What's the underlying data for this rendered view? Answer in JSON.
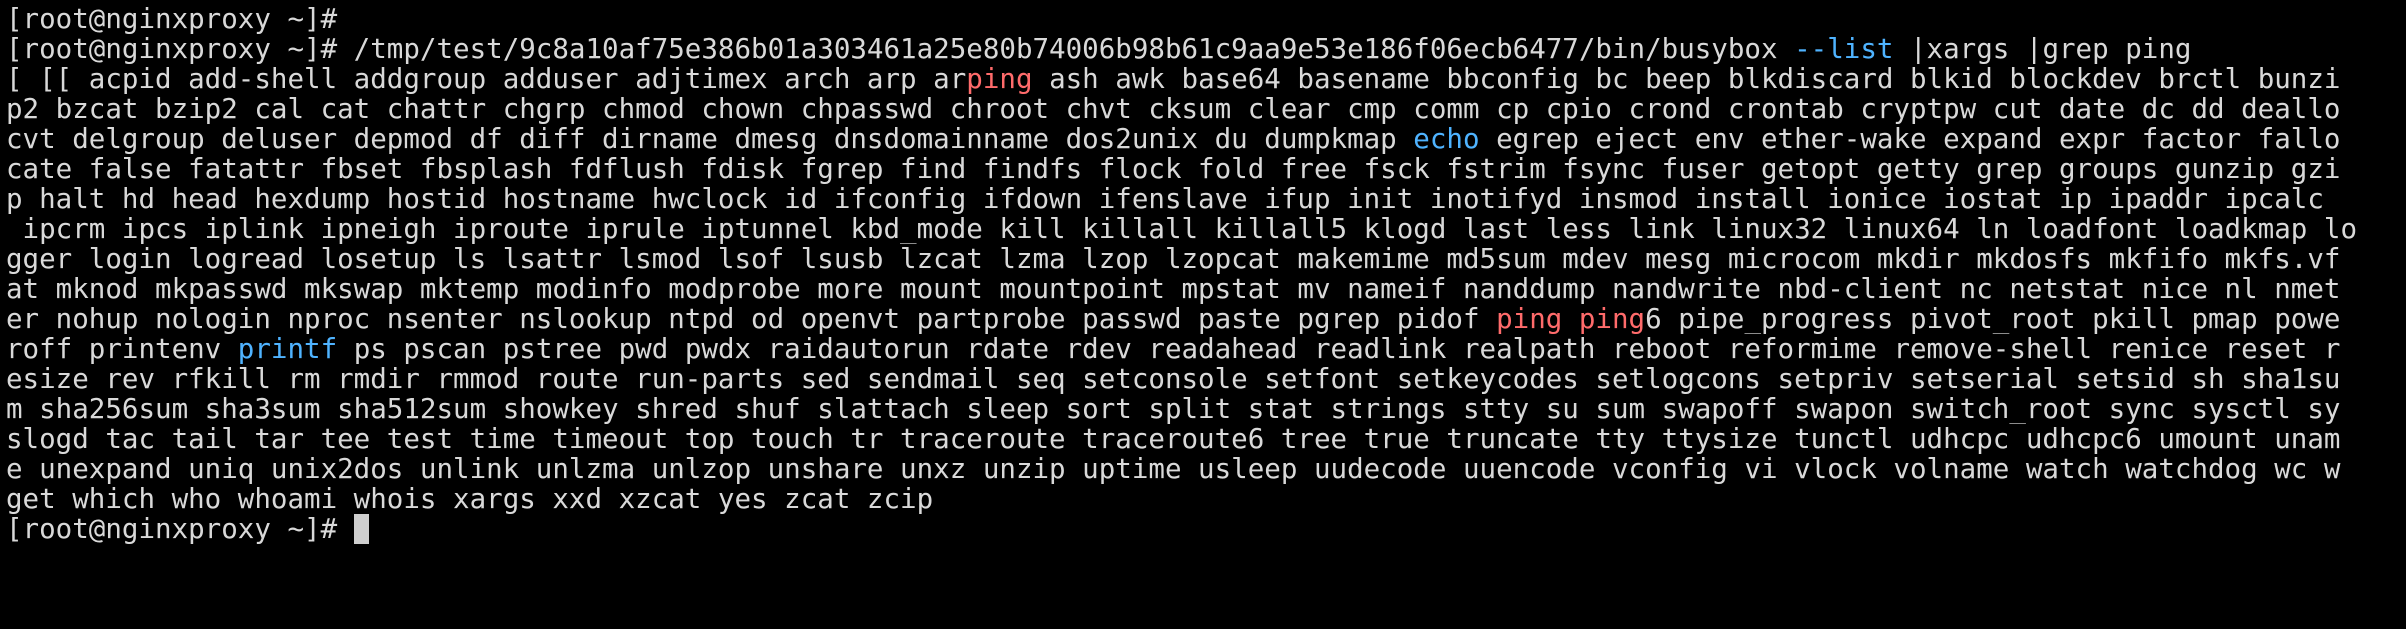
{
  "terminal": {
    "prompt": "[root@nginxproxy ~]# ",
    "colors": {
      "background": "#000000",
      "text": "#d9d9d9",
      "match": "#ff6b6b",
      "builtin": "#4fb3ff",
      "cursor": "#cfcfcf"
    },
    "cursor_icon": "block-cursor-icon",
    "lines": [
      {
        "segments": [
          {
            "text": "[root@nginxproxy ~]#"
          }
        ]
      },
      {
        "segments": [
          {
            "text": "[root@nginxproxy ~]# /tmp/test/9c8a10af75e386b01a303461a25e80b74006b98b61c9aa9e53e186f06ecb6477/bin/busybox "
          },
          {
            "text": "--list",
            "color": "builtin"
          },
          {
            "text": " |xargs |grep ping"
          }
        ]
      },
      {
        "segments": [
          {
            "text": "[ [[ acpid add-shell addgroup adduser adjtimex arch arp ar"
          },
          {
            "text": "ping",
            "color": "match"
          },
          {
            "text": " ash awk base64 basename bbconfig bc beep blkdiscard blkid blockdev brctl bunzi"
          }
        ]
      },
      {
        "segments": [
          {
            "text": "p2 bzcat bzip2 cal cat chattr chgrp chmod chown chpasswd chroot chvt cksum clear cmp comm cp cpio crond crontab cryptpw cut date dc dd deallo"
          }
        ]
      },
      {
        "segments": [
          {
            "text": "cvt delgroup deluser depmod df diff dirname dmesg dnsdomainname dos2unix du dumpkmap "
          },
          {
            "text": "echo",
            "color": "builtin"
          },
          {
            "text": " egrep eject env ether-wake expand expr factor fallo"
          }
        ]
      },
      {
        "segments": [
          {
            "text": "cate false fatattr fbset fbsplash fdflush fdisk fgrep find findfs flock fold free fsck fstrim fsync fuser getopt getty grep groups gunzip gzi"
          }
        ]
      },
      {
        "segments": [
          {
            "text": "p halt hd head hexdump hostid hostname hwclock id ifconfig ifdown ifenslave ifup init inotifyd insmod install ionice iostat ip ipaddr ipcalc"
          }
        ]
      },
      {
        "segments": [
          {
            "text": " ipcrm ipcs iplink ipneigh iproute iprule iptunnel kbd_mode kill killall killall5 klogd last less link linux32 linux64 ln loadfont loadkmap lo"
          }
        ]
      },
      {
        "segments": [
          {
            "text": "gger login logread losetup ls lsattr lsmod lsof lsusb lzcat lzma lzop lzopcat makemime md5sum mdev mesg microcom mkdir mkdosfs mkfifo mkfs.vf"
          }
        ]
      },
      {
        "segments": [
          {
            "text": "at mknod mkpasswd mkswap mktemp modinfo modprobe more mount mountpoint mpstat mv nameif nanddump nandwrite nbd-client nc netstat nice nl nmet"
          }
        ]
      },
      {
        "segments": [
          {
            "text": "er nohup nologin nproc nsenter nslookup ntpd od openvt partprobe passwd paste pgrep pidof "
          },
          {
            "text": "ping",
            "color": "match"
          },
          {
            "text": " "
          },
          {
            "text": "ping",
            "color": "match"
          },
          {
            "text": "6 pipe_progress pivot_root pkill pmap powe"
          }
        ]
      },
      {
        "segments": [
          {
            "text": "roff printenv "
          },
          {
            "text": "printf",
            "color": "builtin"
          },
          {
            "text": " ps pscan pstree pwd pwdx raidautorun rdate rdev readahead readlink realpath reboot reformime remove-shell renice reset r"
          }
        ]
      },
      {
        "segments": [
          {
            "text": "esize rev rfkill rm rmdir rmmod route run-parts sed sendmail seq setconsole setfont setkeycodes setlogcons setpriv setserial setsid sh sha1su"
          }
        ]
      },
      {
        "segments": [
          {
            "text": "m sha256sum sha3sum sha512sum showkey shred shuf slattach sleep sort split stat strings stty su sum swapoff swapon switch_root sync sysctl sy"
          }
        ]
      },
      {
        "segments": [
          {
            "text": "slogd tac tail tar tee test time timeout top touch tr traceroute traceroute6 tree true truncate tty ttysize tunctl udhcpc udhcpc6 umount unam"
          }
        ]
      },
      {
        "segments": [
          {
            "text": "e unexpand uniq unix2dos unlink unlzma unlzop unshare unxz unzip uptime usleep uudecode uuencode vconfig vi vlock volname watch watchdog wc w"
          }
        ]
      },
      {
        "segments": [
          {
            "text": "get which who whoami whois xargs xxd xzcat yes zcat zcip"
          }
        ]
      },
      {
        "segments": [
          {
            "text": "[root@nginxproxy ~]# "
          }
        ],
        "cursor": true
      }
    ]
  }
}
